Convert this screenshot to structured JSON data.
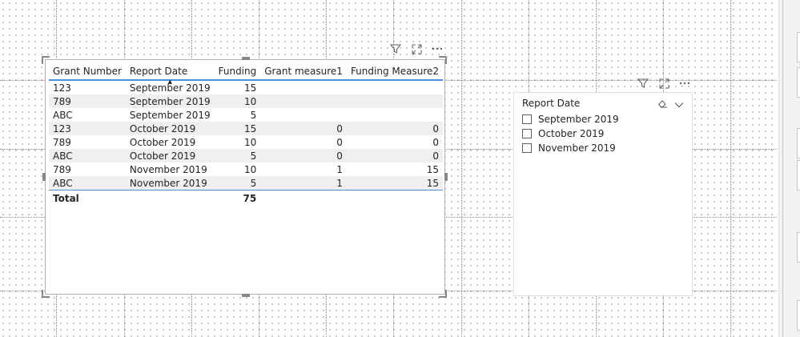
{
  "table": {
    "columns": [
      {
        "label": "Grant Number",
        "align": "left"
      },
      {
        "label": "Report Date",
        "align": "left",
        "sorted": "ascending"
      },
      {
        "label": "Funding",
        "align": "right"
      },
      {
        "label": "Grant measure1",
        "align": "right"
      },
      {
        "label": "Funding Measure2",
        "align": "right"
      }
    ],
    "rows": [
      [
        "123",
        "September 2019",
        "15",
        "",
        ""
      ],
      [
        "789",
        "September 2019",
        "10",
        "",
        ""
      ],
      [
        "ABC",
        "September 2019",
        "5",
        "",
        ""
      ],
      [
        "123",
        "October 2019",
        "15",
        "0",
        "0"
      ],
      [
        "789",
        "October 2019",
        "10",
        "0",
        "0"
      ],
      [
        "ABC",
        "October 2019",
        "5",
        "0",
        "0"
      ],
      [
        "789",
        "November 2019",
        "10",
        "1",
        "15"
      ],
      [
        "ABC",
        "November 2019",
        "5",
        "1",
        "15"
      ]
    ],
    "total": {
      "label": "Total",
      "funding": "75"
    }
  },
  "slicer": {
    "title": "Report Date",
    "items": [
      "September 2019",
      "October 2019",
      "November 2019"
    ]
  },
  "icons": {
    "filter": "filter-icon",
    "focus": "focus-mode-icon",
    "more": "more-options-icon",
    "eraser": "eraser-icon",
    "chevron": "chevron-down-icon"
  },
  "colors": {
    "accent": "#4a90e2",
    "row_alt": "#efefef",
    "text": "#252423"
  }
}
